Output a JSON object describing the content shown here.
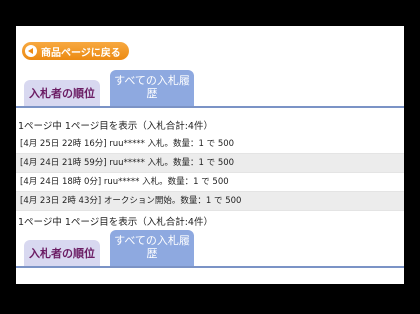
{
  "back_button": {
    "label": "商品ページに戻る",
    "icon": "back-arrow-icon"
  },
  "tabs": [
    {
      "label": "入札者の順位"
    },
    {
      "label": "すべての入札履歴"
    }
  ],
  "pager_text": "1ページ中 1ページ目を表示（入札合計:4件）",
  "bids": [
    {
      "text": "[4月 25日 22時 16分] ruu***** 入札。数量：1 で 500"
    },
    {
      "text": "[4月 24日 21時 59分] ruu***** 入札。数量：1 で 500"
    },
    {
      "text": "[4月 24日 18時 0分] ruu***** 入札。数量：1 で 500"
    },
    {
      "text": "[4月 23日 2時 43分] オークション開始。数量：1 で 500"
    }
  ],
  "colors": {
    "orange": "#ec8a12",
    "tab_active": "#8ea9e0",
    "tab_inactive": "#d8d8f0",
    "tab_text": "#6b1c63"
  }
}
